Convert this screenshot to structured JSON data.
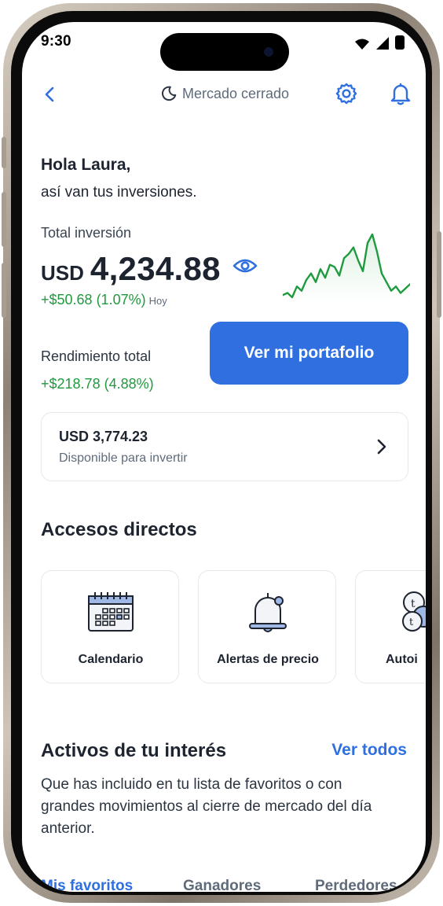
{
  "status_bar": {
    "time": "9:30"
  },
  "header": {
    "market_status": "Mercado cerrado"
  },
  "greeting": {
    "title": "Hola Laura,",
    "subtitle": "así van tus inversiones."
  },
  "total_investment": {
    "label": "Total inversión",
    "currency": "USD",
    "amount": "4,234.88",
    "daily_change": "+$50.68 (1.07%)",
    "daily_change_period": "Hoy",
    "sparkline_values": [
      2,
      3,
      1,
      6,
      4,
      9,
      12,
      8,
      14,
      10,
      16,
      15,
      11,
      19,
      21,
      24,
      18,
      13,
      26,
      30,
      22,
      12,
      8,
      4,
      6,
      3,
      5,
      7
    ]
  },
  "performance": {
    "label": "Rendimiento total",
    "value": "+$218.78 (4.88%)"
  },
  "portfolio_button": {
    "label": "Ver mi portafolio"
  },
  "available": {
    "amount": "USD 3,774.23",
    "label": "Disponible para invertir"
  },
  "shortcuts": {
    "title": "Accesos directos",
    "items": [
      {
        "label": "Calendario",
        "icon": "calendar-icon"
      },
      {
        "label": "Alertas de precio",
        "icon": "bell-alert-icon"
      },
      {
        "label": "Autoi",
        "icon": "coins-icon"
      }
    ]
  },
  "assets": {
    "title": "Activos de tu interés",
    "see_all": "Ver todos",
    "description": "Que has incluido en tu lista de favoritos o con grandes movimientos al cierre de mercado del día anterior.",
    "tabs": [
      "Mis favoritos",
      "Ganadores",
      "Perdedores"
    ]
  },
  "colors": {
    "accent": "#2f6fe0",
    "positive": "#1f9a3e",
    "text": "#1d2430"
  }
}
